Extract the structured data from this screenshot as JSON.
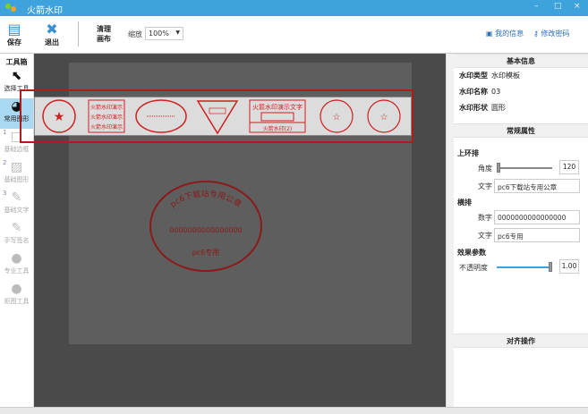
{
  "app": {
    "title": "火箭水印",
    "minimize": "–",
    "maximize": "□",
    "close": "×"
  },
  "toolbar": {
    "save": "保存",
    "exit": "退出",
    "clear": "清理画布",
    "zoom_label": "缩放",
    "zoom_value": "100%",
    "my_info": "我的信息",
    "change_password": "修改密码"
  },
  "toolbox": {
    "title": "工具箱",
    "items": [
      {
        "label": "选择工具",
        "num": ""
      },
      {
        "label": "常用图形",
        "num": ""
      },
      {
        "label": "基础边框",
        "num": "1"
      },
      {
        "label": "基础图形",
        "num": "2"
      },
      {
        "label": "基础文字",
        "num": "3"
      },
      {
        "label": "手写签名",
        "num": ""
      },
      {
        "label": "专业工具",
        "num": ""
      },
      {
        "label": "抠图工具",
        "num": ""
      }
    ]
  },
  "stamps": {
    "rect_text": "火箭水印演示",
    "wide_text": "火箭水印演示文字",
    "wide_sub": "火箭水印(2)",
    "small": "火箭水印"
  },
  "canvas_stamp": {
    "arc_text": "pc6下载站专用公章",
    "number": "0000000000000000",
    "bottom": "pc6专用",
    "color": "#8b1a1a"
  },
  "panel": {
    "basic_title": "基本信息",
    "type_label": "水印类型",
    "type_value": "水印模板",
    "name_label": "水印名称",
    "name_value": "03",
    "shape_label": "水印形状",
    "shape_value": "圆形",
    "props_title": "常规属性",
    "upper_ring": "上环排",
    "angle_label": "角度",
    "angle_value": "120",
    "upper_text_label": "文字",
    "upper_text_value": "pc6下载站专用公章",
    "horizontal": "横排",
    "digits_label": "数字",
    "digits_value": "0000000000000000",
    "h_text_label": "文字",
    "h_text_value": "pc6专用",
    "effects": "效果参数",
    "opacity_label": "不透明度",
    "opacity_value": "1.00",
    "align_title": "对齐操作"
  },
  "colors": {
    "accent": "#3ea3dc",
    "stamp_red": "#d02020",
    "highlight": "#b01c1c"
  }
}
